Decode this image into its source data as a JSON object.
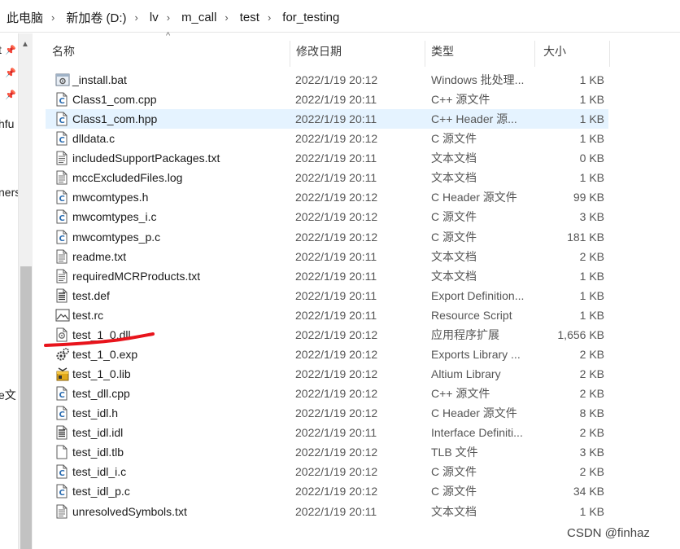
{
  "breadcrumb": [
    "此电脑",
    "新加卷 (D:)",
    "lv",
    "m_call",
    "test",
    "for_testing"
  ],
  "nav_fragments": [
    "t",
    "hfu",
    "ners",
    "e文"
  ],
  "columns": {
    "name": "名称",
    "date": "修改日期",
    "type": "类型",
    "size": "大小"
  },
  "files": [
    {
      "name": "_install.bat",
      "date": "2022/1/19 20:12",
      "type": "Windows 批处理...",
      "size": "1 KB",
      "icon": "batch-file-icon"
    },
    {
      "name": "Class1_com.cpp",
      "date": "2022/1/19 20:11",
      "type": "C++ 源文件",
      "size": "1 KB",
      "icon": "c-source-file-icon"
    },
    {
      "name": "Class1_com.hpp",
      "date": "2022/1/19 20:11",
      "type": "C++ Header 源...",
      "size": "1 KB",
      "icon": "c-source-file-icon",
      "selected": true
    },
    {
      "name": "dlldata.c",
      "date": "2022/1/19 20:12",
      "type": "C 源文件",
      "size": "1 KB",
      "icon": "c-source-file-icon"
    },
    {
      "name": "includedSupportPackages.txt",
      "date": "2022/1/19 20:11",
      "type": "文本文档",
      "size": "0 KB",
      "icon": "text-file-icon"
    },
    {
      "name": "mccExcludedFiles.log",
      "date": "2022/1/19 20:11",
      "type": "文本文档",
      "size": "1 KB",
      "icon": "text-file-icon"
    },
    {
      "name": "mwcomtypes.h",
      "date": "2022/1/19 20:12",
      "type": "C Header 源文件",
      "size": "99 KB",
      "icon": "c-source-file-icon"
    },
    {
      "name": "mwcomtypes_i.c",
      "date": "2022/1/19 20:12",
      "type": "C 源文件",
      "size": "3 KB",
      "icon": "c-source-file-icon"
    },
    {
      "name": "mwcomtypes_p.c",
      "date": "2022/1/19 20:12",
      "type": "C 源文件",
      "size": "181 KB",
      "icon": "c-source-file-icon"
    },
    {
      "name": "readme.txt",
      "date": "2022/1/19 20:11",
      "type": "文本文档",
      "size": "2 KB",
      "icon": "text-file-icon"
    },
    {
      "name": "requiredMCRProducts.txt",
      "date": "2022/1/19 20:11",
      "type": "文本文档",
      "size": "1 KB",
      "icon": "text-file-icon"
    },
    {
      "name": "test.def",
      "date": "2022/1/19 20:11",
      "type": "Export Definition...",
      "size": "1 KB",
      "icon": "definition-file-icon"
    },
    {
      "name": "test.rc",
      "date": "2022/1/19 20:11",
      "type": "Resource Script",
      "size": "1 KB",
      "icon": "image-file-icon"
    },
    {
      "name": "test_1_0.dll",
      "date": "2022/1/19 20:12",
      "type": "应用程序扩展",
      "size": "1,656 KB",
      "icon": "dll-file-icon"
    },
    {
      "name": "test_1_0.exp",
      "date": "2022/1/19 20:12",
      "type": "Exports Library ...",
      "size": "2 KB",
      "icon": "gear-file-icon"
    },
    {
      "name": "test_1_0.lib",
      "date": "2022/1/19 20:12",
      "type": "Altium Library",
      "size": "2 KB",
      "icon": "library-file-icon"
    },
    {
      "name": "test_dll.cpp",
      "date": "2022/1/19 20:12",
      "type": "C++ 源文件",
      "size": "2 KB",
      "icon": "c-source-file-icon"
    },
    {
      "name": "test_idl.h",
      "date": "2022/1/19 20:12",
      "type": "C Header 源文件",
      "size": "8 KB",
      "icon": "c-source-file-icon"
    },
    {
      "name": "test_idl.idl",
      "date": "2022/1/19 20:11",
      "type": "Interface Definiti...",
      "size": "2 KB",
      "icon": "definition-file-icon"
    },
    {
      "name": "test_idl.tlb",
      "date": "2022/1/19 20:12",
      "type": "TLB 文件",
      "size": "3 KB",
      "icon": "blank-file-icon"
    },
    {
      "name": "test_idl_i.c",
      "date": "2022/1/19 20:12",
      "type": "C 源文件",
      "size": "2 KB",
      "icon": "c-source-file-icon"
    },
    {
      "name": "test_idl_p.c",
      "date": "2022/1/19 20:12",
      "type": "C 源文件",
      "size": "34 KB",
      "icon": "c-source-file-icon"
    },
    {
      "name": "unresolvedSymbols.txt",
      "date": "2022/1/19 20:11",
      "type": "文本文档",
      "size": "1 KB",
      "icon": "text-file-icon"
    }
  ],
  "annotation_color": "#e8141c",
  "watermark": "CSDN @finhaz"
}
